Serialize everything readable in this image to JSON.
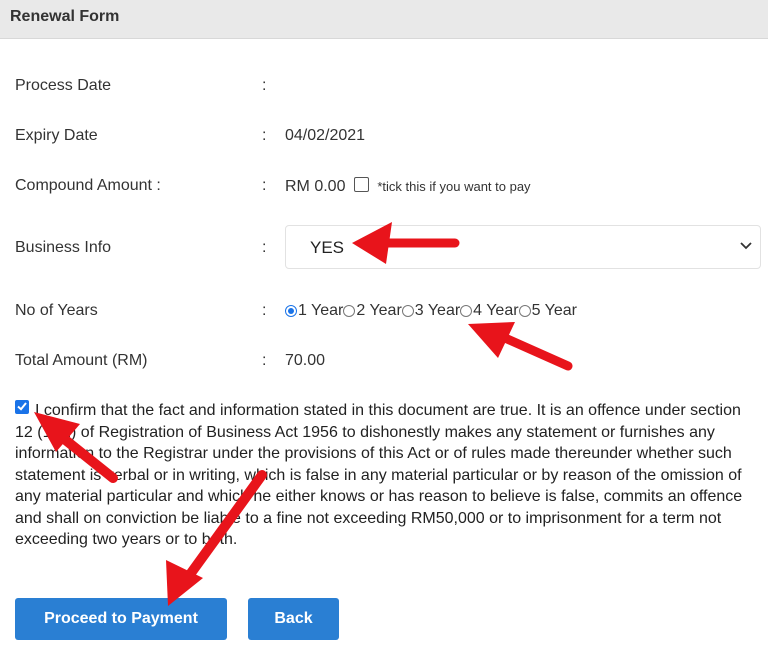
{
  "header": {
    "title": "Renewal Form"
  },
  "form": {
    "process_date": {
      "label": "Process Date",
      "colon": ":",
      "value": ""
    },
    "expiry_date": {
      "label": "Expiry Date",
      "colon": ":",
      "value": "04/02/2021"
    },
    "compound_amount": {
      "label": "Compound Amount :",
      "colon": ":",
      "value": "RM 0.00",
      "checkbox_checked": false,
      "note": "*tick this if you want to pay"
    },
    "business_info": {
      "label": "Business Info",
      "colon": ":",
      "selected": "YES"
    },
    "no_of_years": {
      "label": "No of Years",
      "colon": ":",
      "options": [
        "1 Year",
        "2 Year",
        "3 Year",
        "4 Year",
        "5 Year"
      ],
      "selected_index": 0
    },
    "total_amount": {
      "label": "Total Amount (RM)",
      "colon": ":",
      "value": "70.00"
    }
  },
  "confirmation": {
    "checked": true,
    "text": "I confirm that the fact and information stated in this document are true. It is an offence under section 12 (1)(d) of Registration of Business Act 1956 to dishonestly makes any statement or furnishes any information to the Registrar under the provisions of this Act or of rules made thereunder whether such statement is verbal or in writing, which is false in any material particular or by reason of the omission of any material particular and which he either knows or has reason to believe is false, commits an offence and shall on conviction be liable to a fine not exceeding RM50,000 or to imprisonment for a term not exceeding two years or to both."
  },
  "buttons": {
    "proceed_label": "Proceed to Payment",
    "back_label": "Back"
  },
  "colors": {
    "accent": "#2a7fd3",
    "arrow": "#e8141b",
    "header_bg": "#e9e9e9"
  }
}
